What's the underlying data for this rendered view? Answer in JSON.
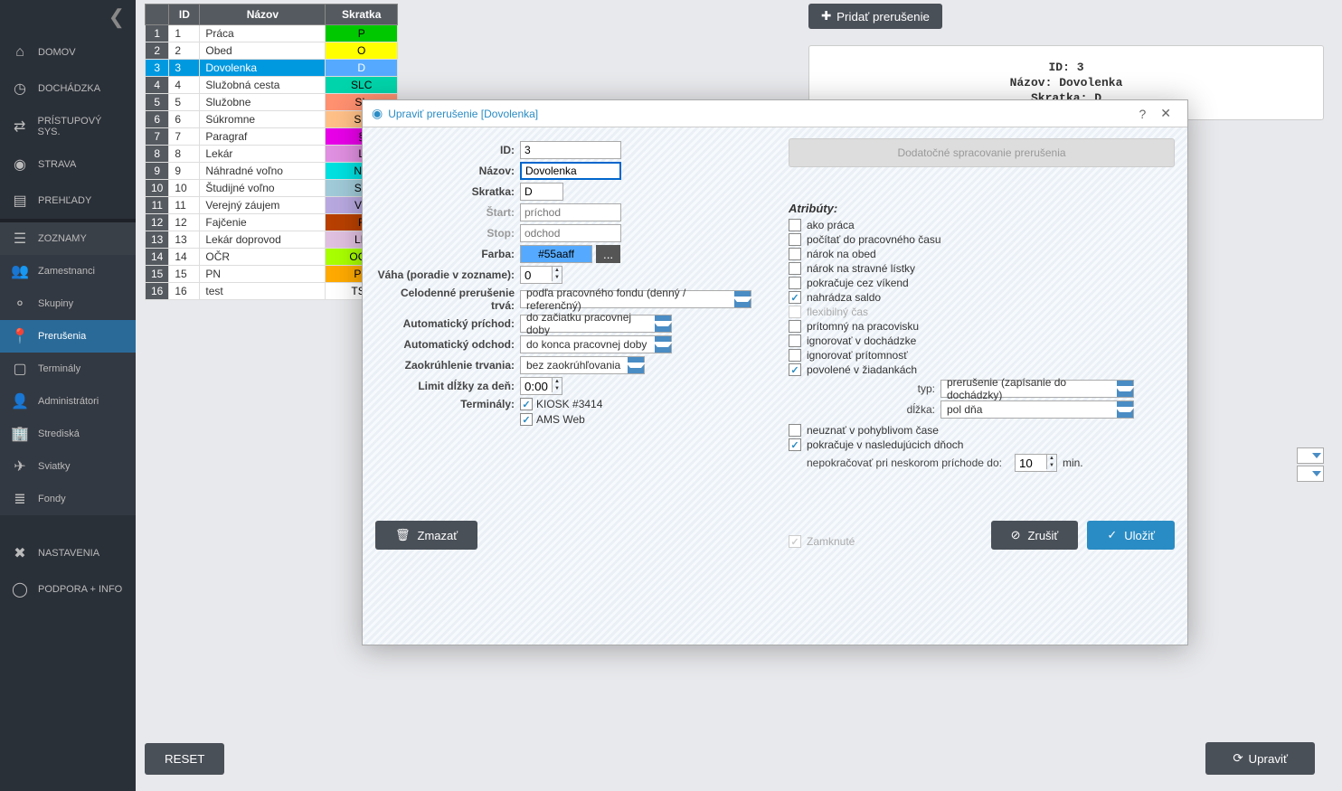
{
  "sidebar": {
    "main": [
      {
        "label": "DOMOV",
        "icon": "home"
      },
      {
        "label": "DOCHÁDZKA",
        "icon": "clock"
      },
      {
        "label": "PRÍSTUPOVÝ SYS.",
        "icon": "access"
      },
      {
        "label": "STRAVA",
        "icon": "food"
      },
      {
        "label": "PREHĽADY",
        "icon": "reports"
      }
    ],
    "sub": [
      {
        "label": "ZOZNAMY",
        "icon": "list",
        "active": false,
        "header": true
      },
      {
        "label": "Zamestnanci",
        "icon": "people"
      },
      {
        "label": "Skupiny",
        "icon": "groups"
      },
      {
        "label": "Prerušenia",
        "icon": "pins",
        "active": true
      },
      {
        "label": "Terminály",
        "icon": "terminal"
      },
      {
        "label": "Administrátori",
        "icon": "admin"
      },
      {
        "label": "Strediská",
        "icon": "building"
      },
      {
        "label": "Sviatky",
        "icon": "holiday"
      },
      {
        "label": "Fondy",
        "icon": "stack"
      }
    ],
    "bottom": [
      {
        "label": "NASTAVENIA",
        "icon": "wrench"
      },
      {
        "label": "PODPORA + INFO",
        "icon": "support"
      }
    ]
  },
  "table": {
    "headers": {
      "id": "ID",
      "name": "Názov",
      "short": "Skratka"
    },
    "rows": [
      {
        "n": "1",
        "id": "1",
        "name": "Práca",
        "short": "P",
        "color": "#00c800"
      },
      {
        "n": "2",
        "id": "2",
        "name": "Obed",
        "short": "O",
        "color": "#ffff00"
      },
      {
        "n": "3",
        "id": "3",
        "name": "Dovolenka",
        "short": "D",
        "color": "#55aaff",
        "selected": true
      },
      {
        "n": "4",
        "id": "4",
        "name": "Služobná cesta",
        "short": "SLC",
        "color": "#00d4aa"
      },
      {
        "n": "5",
        "id": "5",
        "name": "Služobne",
        "short": "SL",
        "color": "#ff9070"
      },
      {
        "n": "6",
        "id": "6",
        "name": "Súkromne",
        "short": "SU",
        "color": "#ffc088"
      },
      {
        "n": "7",
        "id": "7",
        "name": "Paragraf",
        "short": "§",
        "color": "#e800e8"
      },
      {
        "n": "8",
        "id": "8",
        "name": "Lekár",
        "short": "L",
        "color": "#e090e0"
      },
      {
        "n": "9",
        "id": "9",
        "name": "Náhradné voľno",
        "short": "NV",
        "color": "#00e0e0"
      },
      {
        "n": "10",
        "id": "10",
        "name": "Študijné voľno",
        "short": "SV",
        "color": "#a0cad8"
      },
      {
        "n": "11",
        "id": "11",
        "name": "Verejný záujem",
        "short": "VZ",
        "color": "#b8a8e0"
      },
      {
        "n": "12",
        "id": "12",
        "name": "Fajčenie",
        "short": "F",
        "color": "#b84000"
      },
      {
        "n": "13",
        "id": "13",
        "name": "Lekár doprovod",
        "short": "LD",
        "color": "#e0c0e0"
      },
      {
        "n": "14",
        "id": "14",
        "name": "OČR",
        "short": "OCR",
        "color": "#a8ff00"
      },
      {
        "n": "15",
        "id": "15",
        "name": "PN",
        "short": "PN",
        "color": "#ffaa00"
      },
      {
        "n": "16",
        "id": "16",
        "name": "test",
        "short": "TST",
        "color": "#ffffff"
      }
    ]
  },
  "rightPanel": {
    "addButton": "Pridať prerušenie",
    "info": {
      "id_label": "ID:",
      "id": "3",
      "name_label": "Názov:",
      "name": "Dovolenka",
      "short_label": "Skratka:",
      "short": "D"
    }
  },
  "footer": {
    "reset": "RESET",
    "edit": "Upraviť"
  },
  "dialog": {
    "title": "Upraviť prerušenie [Dovolenka]",
    "bigButton": "Dodatočné spracovanie prerušenia",
    "labels": {
      "id": "ID:",
      "name": "Názov:",
      "short": "Skratka:",
      "start": "Štart:",
      "stop": "Stop:",
      "color": "Farba:",
      "weight": "Váha (poradie v zozname):",
      "fullday": "Celodenné prerušenie trvá:",
      "autoIn": "Automatický príchod:",
      "autoOut": "Automatický odchod:",
      "rounding": "Zaokrúhlenie trvania:",
      "dayLimit": "Limit dĺžky za deň:",
      "terminals": "Terminály:"
    },
    "values": {
      "id": "3",
      "name": "Dovolenka",
      "short": "D",
      "start": "príchod",
      "stop": "odchod",
      "color": "#55aaff",
      "weight": "0",
      "fullday": "podľa pracovného fondu (denný / referenčný)",
      "autoIn": "do začiatku pracovnej doby",
      "autoOut": "do konca pracovnej doby",
      "rounding": "bez zaokrúhľovania",
      "dayLimit": "0:00",
      "terminal1": "KIOSK #3414",
      "terminal2": "AMS Web",
      "typ": "prerušenie (zapísanie do dochádzky)",
      "dlzka": "pol dňa",
      "nepokracovat": "10"
    },
    "colorBtn": "...",
    "attrs": {
      "title": "Atribúty:",
      "list": [
        {
          "label": "ako práca",
          "checked": false
        },
        {
          "label": "počítať do pracovného času",
          "checked": false
        },
        {
          "label": "nárok na obed",
          "checked": false
        },
        {
          "label": "nárok na stravné lístky",
          "checked": false
        },
        {
          "label": "pokračuje cez víkend",
          "checked": false
        },
        {
          "label": "nahrádza saldo",
          "checked": true
        },
        {
          "label": "flexibilný čas",
          "checked": false,
          "muted": true
        },
        {
          "label": "prítomný na pracovisku",
          "checked": false
        },
        {
          "label": "ignorovať v dochádzke",
          "checked": false
        },
        {
          "label": "ignorovať prítomnosť",
          "checked": false
        },
        {
          "label": "povolené v žiadankách",
          "checked": true
        }
      ],
      "typLabel": "typ:",
      "dlzkaLabel": "dĺžka:",
      "extra": [
        {
          "label": "neuznať v pohyblivom čase",
          "checked": false
        },
        {
          "label": "pokračuje v nasledujúcich dňoch",
          "checked": true
        }
      ],
      "nepokLabel": "nepokračovať pri neskorom príchode do:",
      "nepokUnit": "min.",
      "locked": {
        "label": "Zamknuté",
        "checked": true,
        "muted": true
      }
    },
    "footerBtns": {
      "delete": "Zmazať",
      "cancel": "Zrušiť",
      "save": "Uložiť"
    }
  }
}
